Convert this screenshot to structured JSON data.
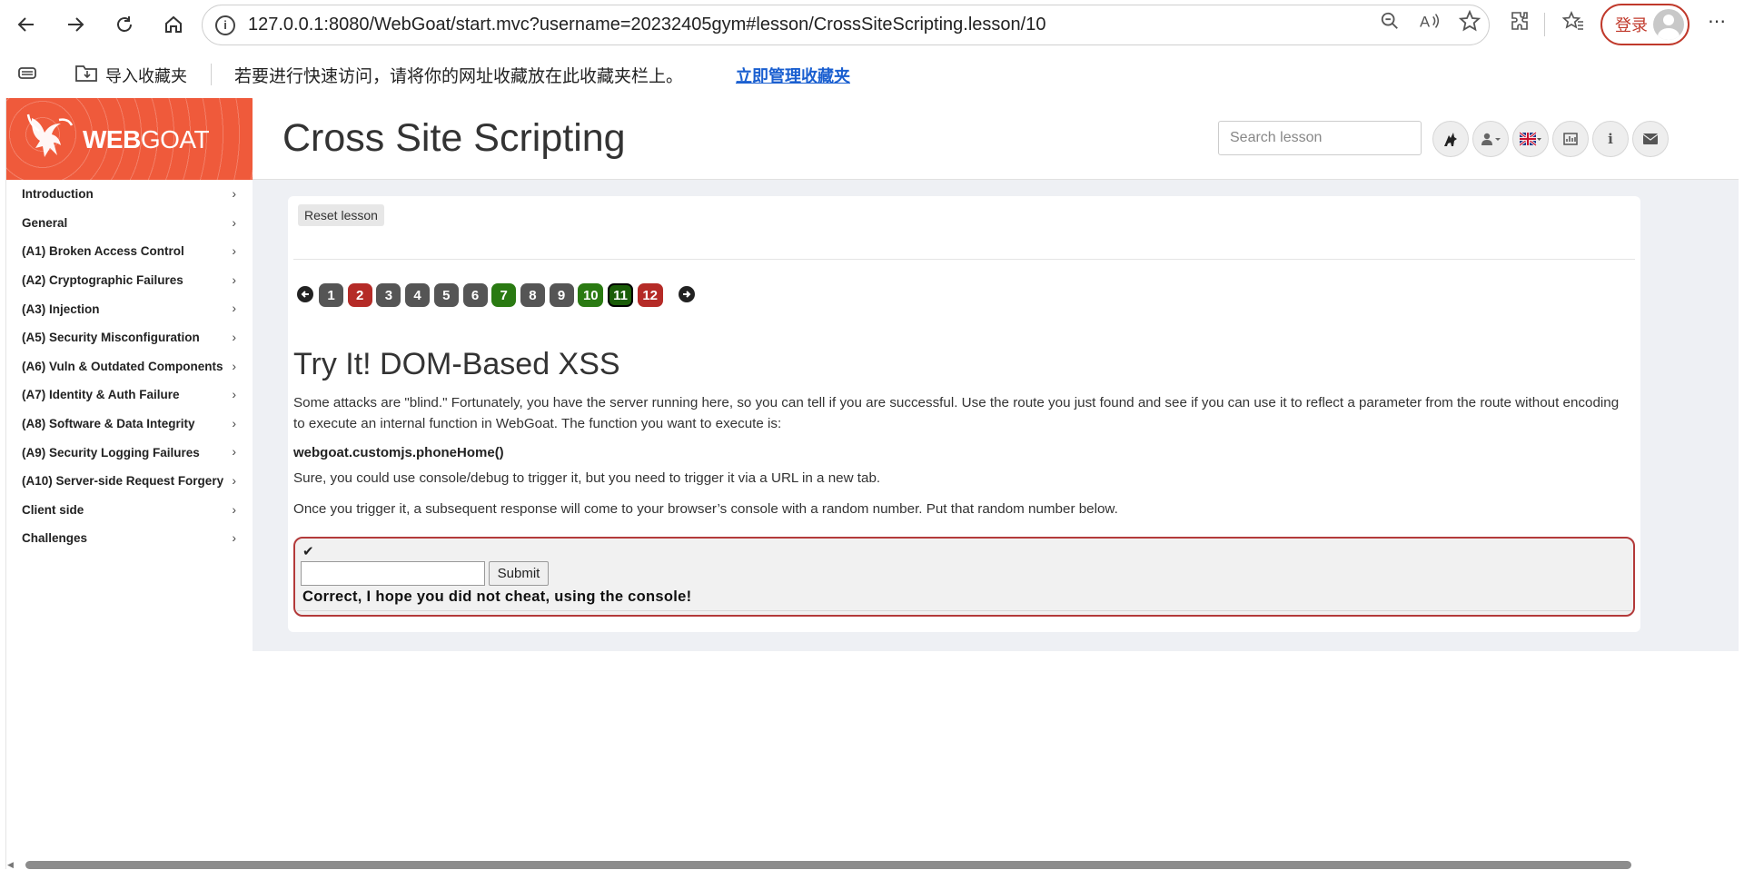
{
  "browser": {
    "url": "127.0.0.1:8080/WebGoat/start.mvc?username=20232405gym#lesson/CrossSiteScripting.lesson/10",
    "login_label": "登录",
    "bookmarks": {
      "import_label": "导入收藏夹",
      "hint_text": "若要进行快速访问，请将你的网址收藏放在此收藏夹栏上。",
      "manage_link": "立即管理收藏夹"
    }
  },
  "app": {
    "logo_web": "WEB",
    "logo_goat": "GOAT",
    "page_title": "Cross Site Scripting",
    "search_placeholder": "Search lesson"
  },
  "sidebar": {
    "items": [
      {
        "label": "Introduction"
      },
      {
        "label": "General"
      },
      {
        "label": "(A1) Broken Access Control"
      },
      {
        "label": "(A2) Cryptographic Failures"
      },
      {
        "label": "(A3) Injection"
      },
      {
        "label": "(A5) Security Misconfiguration"
      },
      {
        "label": "(A6) Vuln & Outdated Components"
      },
      {
        "label": "(A7) Identity & Auth Failure"
      },
      {
        "label": "(A8) Software & Data Integrity"
      },
      {
        "label": "(A9) Security Logging Failures"
      },
      {
        "label": "(A10) Server-side Request Forgery"
      },
      {
        "label": "Client side"
      },
      {
        "label": "Challenges"
      }
    ]
  },
  "lesson": {
    "reset_label": "Reset lesson",
    "pages": [
      {
        "label": "1",
        "state": "default"
      },
      {
        "label": "2",
        "state": "failed"
      },
      {
        "label": "3",
        "state": "default"
      },
      {
        "label": "4",
        "state": "default"
      },
      {
        "label": "5",
        "state": "default"
      },
      {
        "label": "6",
        "state": "default"
      },
      {
        "label": "7",
        "state": "solved"
      },
      {
        "label": "8",
        "state": "default"
      },
      {
        "label": "9",
        "state": "default"
      },
      {
        "label": "10",
        "state": "solved"
      },
      {
        "label": "11",
        "state": "current-solved"
      },
      {
        "label": "12",
        "state": "failed"
      }
    ],
    "colors": {
      "default": "#555555",
      "failed": "#b52b27",
      "solved": "#2a7a12",
      "current": "#1a5c08"
    },
    "heading": "Try It! DOM-Based XSS",
    "paragraph1": "Some attacks are \"blind.\" Fortunately, you have the server running here, so you can tell if you are successful. Use the route you just found and see if you can use it to reflect a parameter from the route without encoding to execute an internal function in WebGoat. The function you want to execute is:",
    "function_name": "webgoat.customjs.phoneHome()",
    "paragraph2": "Sure, you could use console/debug to trigger it, but you need to trigger it via a URL in a new tab.",
    "paragraph3": "Once you trigger it, a subsequent response will come to your browser’s console with a random number. Put that random number below.",
    "check_mark": "✔",
    "answer_value": "",
    "submit_label": "Submit",
    "feedback": "Correct, I hope you did not cheat, using the console!"
  }
}
